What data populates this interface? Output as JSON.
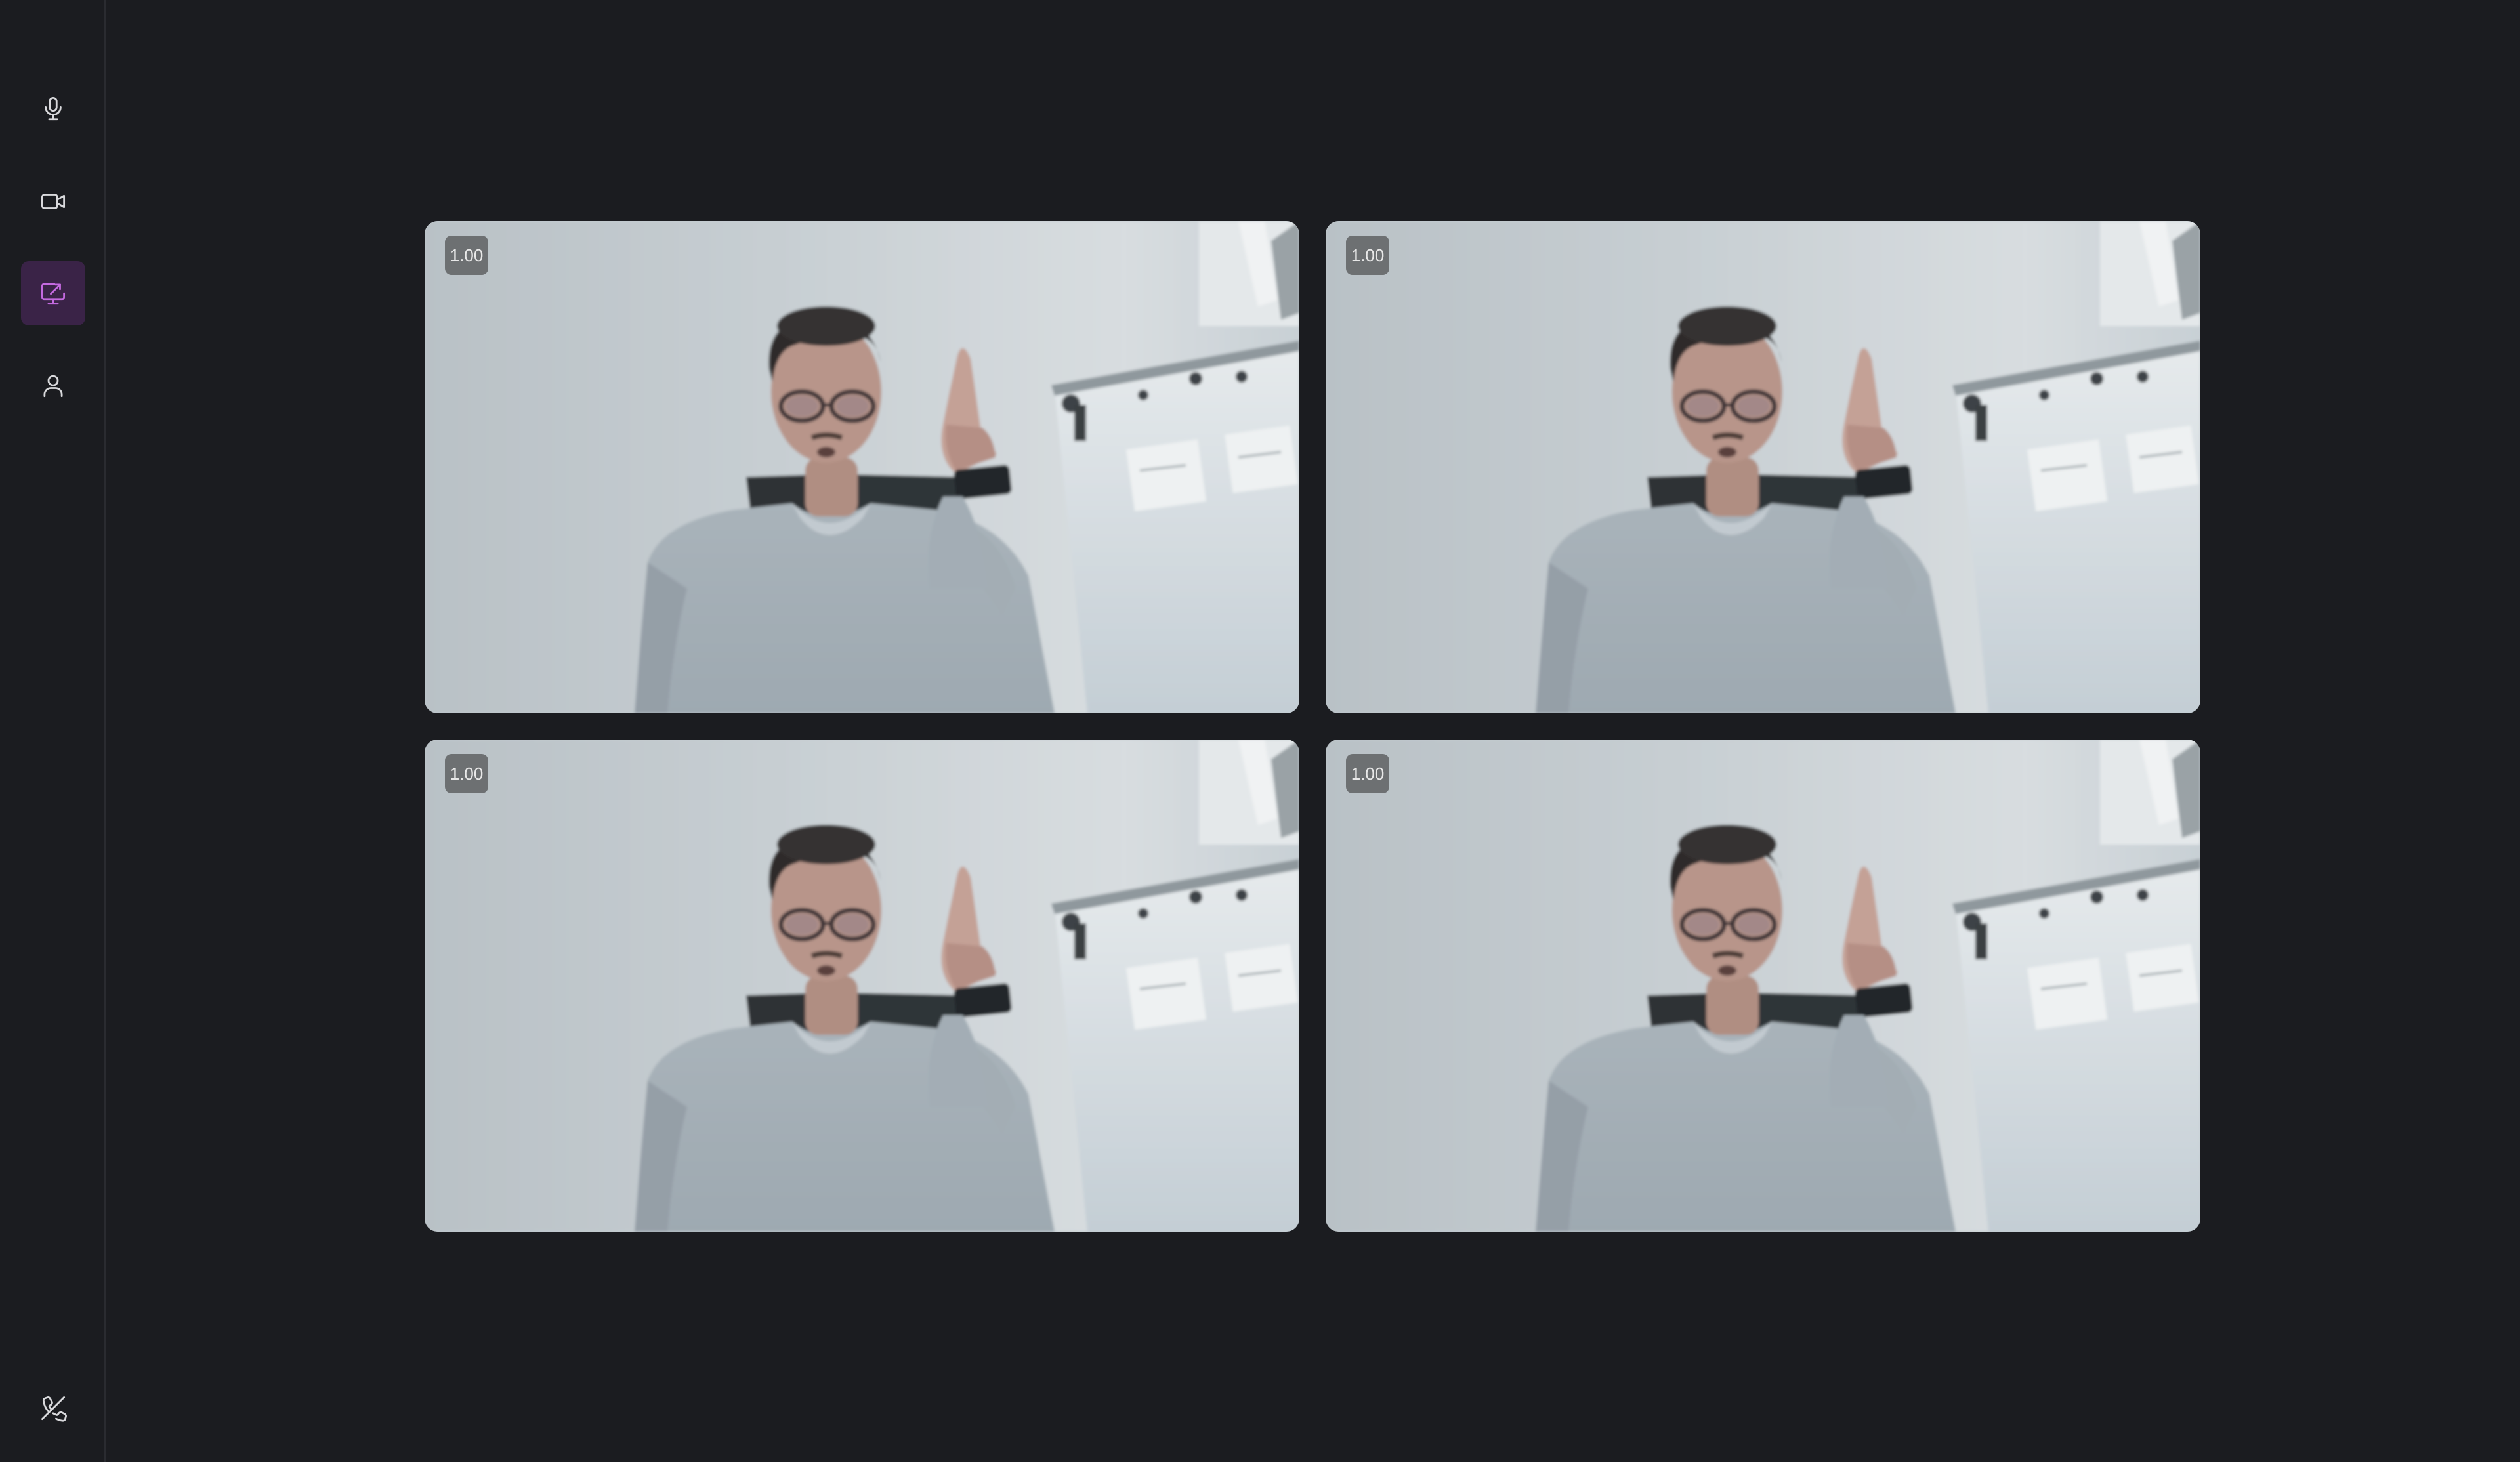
{
  "sidebar": {
    "items": [
      {
        "icon": "microphone-icon",
        "active": false
      },
      {
        "icon": "video-camera-icon",
        "active": false
      },
      {
        "icon": "screen-share-icon",
        "active": true
      },
      {
        "icon": "person-icon",
        "active": false
      }
    ],
    "hangup_icon": "phone-hangup-icon"
  },
  "tiles": [
    {
      "badge": "1.00"
    },
    {
      "badge": "1.00"
    },
    {
      "badge": "1.00"
    },
    {
      "badge": "1.00"
    }
  ],
  "colors": {
    "background": "#1b1c20",
    "active_item_bg": "#3a2347",
    "active_icon": "#c46ae0",
    "icon": "#d9d9dc"
  }
}
